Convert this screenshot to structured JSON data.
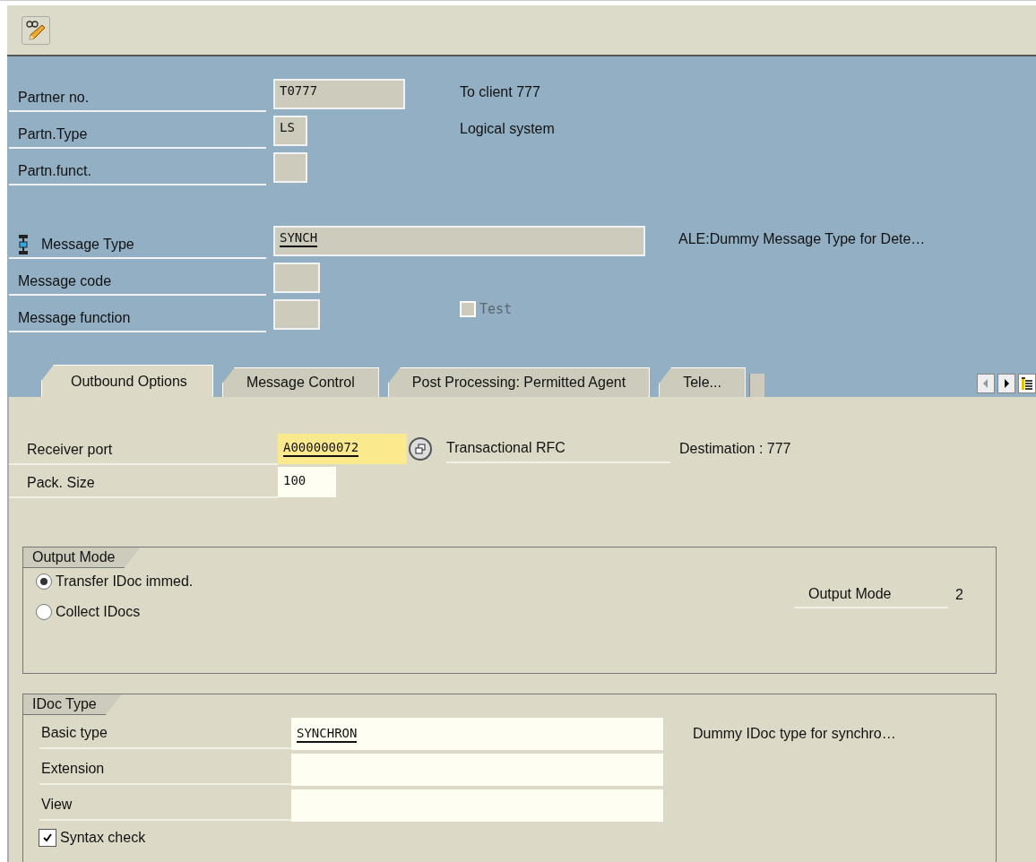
{
  "toolbar": {
    "buttons": [
      {
        "kind": "edit"
      }
    ]
  },
  "partner": {
    "rows": [
      {
        "label": "Partner no.",
        "value": "T0777",
        "description": "To client 777"
      },
      {
        "label": "Partn.Type",
        "value": "LS",
        "description": "Logical system"
      },
      {
        "label": "Partn.funct.",
        "value": ""
      }
    ]
  },
  "message": {
    "rows": [
      {
        "kind": "with_icon",
        "label": "Message Type",
        "value": "SYNCH",
        "underlined": true,
        "description": "ALE:Dummy Message Type for Dete…"
      },
      {
        "kind": "plain",
        "label": "Message code",
        "value": ""
      },
      {
        "kind": "plain",
        "label": "Message function",
        "value": ""
      }
    ],
    "test": {
      "label": "Test",
      "checked": false,
      "disabled": true
    }
  },
  "tabs": [
    {
      "label": "Outbound Options",
      "selected": true
    },
    {
      "label": "Message Control",
      "selected": false
    },
    {
      "label": "Post Processing: Permitted Agent",
      "selected": false
    },
    {
      "label": "Tele...",
      "selected": false
    }
  ],
  "outbound": {
    "receiver_port": {
      "label": "Receiver port",
      "value": "A000000072",
      "underlined": true,
      "focused": true,
      "description": "Transactional RFC",
      "destination": "Destimation : 777"
    },
    "pack_size": {
      "label": "Pack. Size",
      "value": "100"
    },
    "output_mode": {
      "title": "Output Mode",
      "options": [
        {
          "label": "Transfer IDoc immed.",
          "selected": true
        },
        {
          "label": "Collect IDocs",
          "selected": false
        }
      ],
      "mode_label": "Output Mode",
      "mode_value": "2"
    },
    "idoc_type": {
      "title": "IDoc Type",
      "rows": [
        {
          "label": "Basic type",
          "value": "SYNCHRON",
          "underlined": true,
          "description": "Dummy IDoc type for synchro…"
        },
        {
          "label": "Extension",
          "value": ""
        },
        {
          "label": "View",
          "value": ""
        }
      ],
      "syntax_check": {
        "label": "Syntax check",
        "checked": true
      }
    }
  }
}
